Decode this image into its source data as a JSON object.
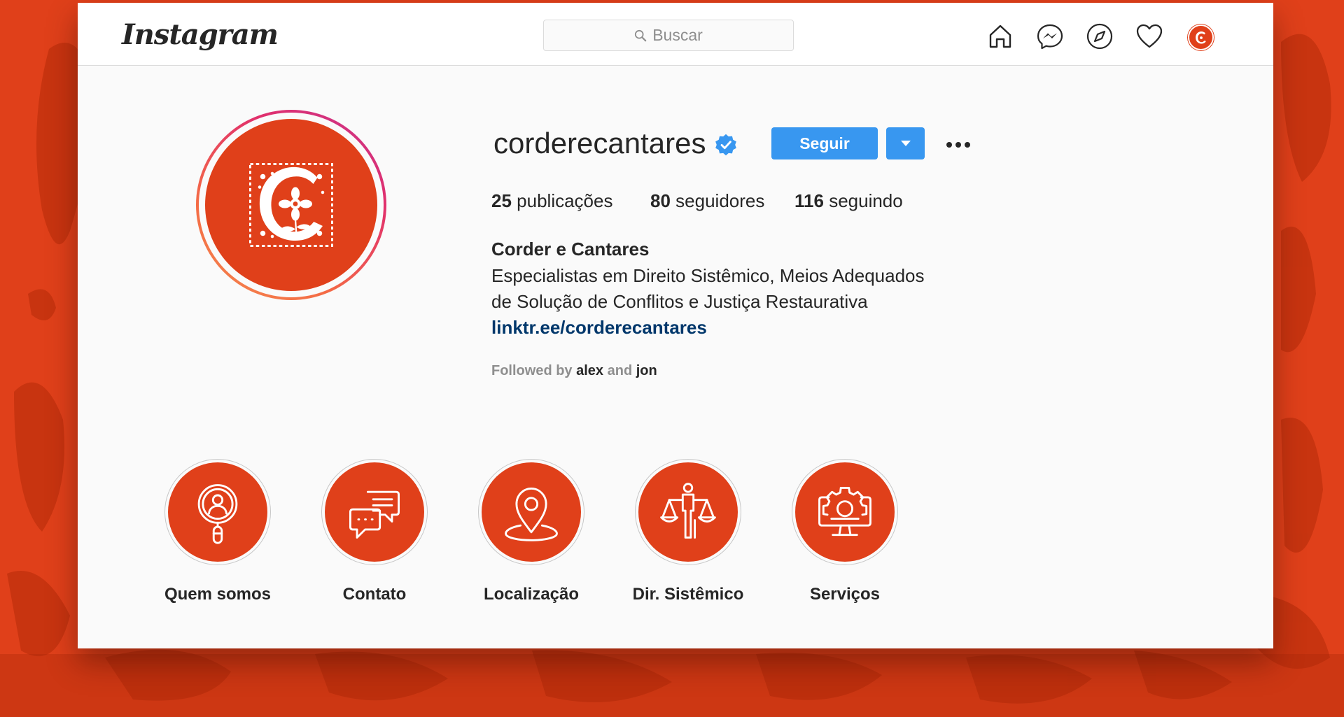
{
  "theme": {
    "accent": "#3897f0",
    "brand": "#e0401a",
    "link": "#00376b"
  },
  "header": {
    "logo": "Instagram",
    "search": {
      "placeholder": "Buscar",
      "icon": "search-icon"
    },
    "nav": [
      "home-icon",
      "messenger-icon",
      "explore-icon",
      "activity-heart-icon",
      "profile-avatar"
    ]
  },
  "profile": {
    "username": "corderecantares",
    "verified": true,
    "follow_label": "Seguir",
    "stats": {
      "posts_count": "25",
      "posts_label": "publicações",
      "followers_count": "80",
      "followers_label": "seguidores",
      "following_count": "116",
      "following_label": "seguindo"
    },
    "display_name": "Corder e Cantares",
    "bio_line1": "Especialistas em Direito Sistêmico, Meios Adequados",
    "bio_line2": "de Solução de Conflitos e Justiça Restaurativa",
    "link": "linktr.ee/corderecantares",
    "followed_by": {
      "prefix": "Followed by",
      "user1": "alex",
      "conj": "and",
      "user2": "jon"
    }
  },
  "highlights": [
    {
      "label": "Quem somos",
      "icon": "search-person-icon"
    },
    {
      "label": "Contato",
      "icon": "chat-icon"
    },
    {
      "label": "Localização",
      "icon": "location-pin-icon"
    },
    {
      "label": "Dir. Sistêmico",
      "icon": "scales-justice-icon"
    },
    {
      "label": "Serviços",
      "icon": "gear-monitor-icon"
    }
  ]
}
